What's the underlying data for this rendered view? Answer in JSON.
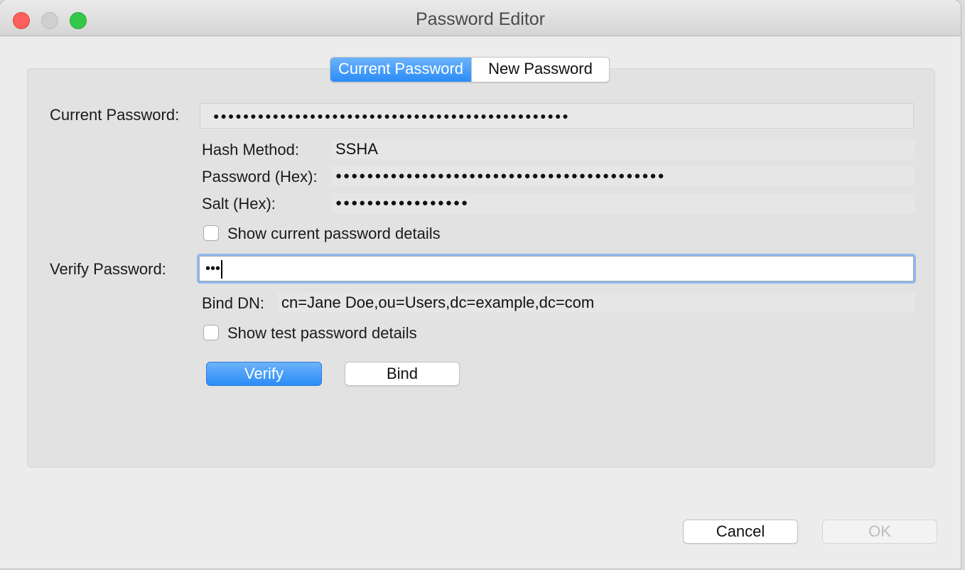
{
  "window": {
    "title": "Password Editor"
  },
  "tabs": [
    {
      "label": "Current Password",
      "active": true
    },
    {
      "label": "New Password",
      "active": false
    }
  ],
  "current_password": {
    "label": "Current Password:",
    "value": "●●●●●●●●●●●●●●●●●●●●●●●●●●●●●●●●●●●●●●●●●●●●●●●●"
  },
  "details": {
    "hash_method_label": "Hash Method:",
    "hash_method_value": "SSHA",
    "password_hex_label": "Password (Hex):",
    "password_hex_value": "●●●●●●●●●●●●●●●●●●●●●●●●●●●●●●●●●●●●●●●●●●",
    "salt_hex_label": "Salt (Hex):",
    "salt_hex_value": "●●●●●●●●●●●●●●●●●"
  },
  "show_current_details": {
    "label": "Show current password details",
    "checked": false
  },
  "verify_password": {
    "label": "Verify Password:",
    "value": "•••"
  },
  "bind_dn": {
    "label": "Bind DN:",
    "value": "cn=Jane Doe,ou=Users,dc=example,dc=com"
  },
  "show_test_details": {
    "label": "Show test password details",
    "checked": false
  },
  "buttons": {
    "verify": "Verify",
    "bind": "Bind",
    "cancel": "Cancel",
    "ok": "OK"
  },
  "colors": {
    "accent": "#2a8cf7",
    "close": "#fc605c",
    "maximize": "#34c84a"
  }
}
